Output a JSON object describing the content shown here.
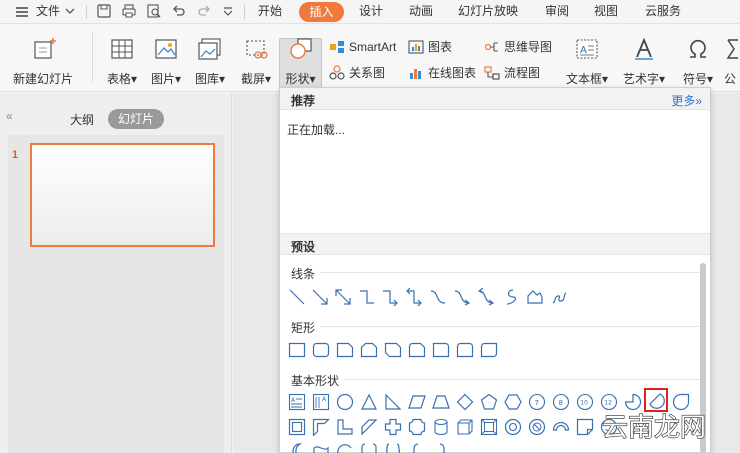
{
  "menubar": {
    "file_label": "文件",
    "tabs": [
      "开始",
      "插入",
      "设计",
      "动画",
      "幻灯片放映",
      "审阅",
      "视图",
      "云服务"
    ],
    "active_tab": "插入"
  },
  "ribbon": {
    "new_slide": "新建幻灯片",
    "table": "表格",
    "picture": "图片",
    "gallery": "图库",
    "screenshot": "截屏",
    "shape": "形状",
    "smartart": "SmartArt",
    "relation": "关系图",
    "chart": "图表",
    "online_chart": "在线图表",
    "mindmap": "思维导图",
    "flowchart": "流程图",
    "textbox": "文本框",
    "wordart": "艺术字",
    "symbol": "符号",
    "formula_partial": "公"
  },
  "left_panel": {
    "collapse_glyph": "«",
    "tab_outline": "大纲",
    "tab_slides": "幻灯片",
    "slide_number": "1"
  },
  "dropdown": {
    "recommend_title": "推荐",
    "more_label": "更多»",
    "loading_text": "正在加载...",
    "preset_title": "预设",
    "categories": {
      "lines": "线条",
      "rectangles": "矩形",
      "basic": "基本形状"
    },
    "numbered_badges": [
      "7",
      "8",
      "10",
      "12"
    ],
    "highlight_color": "#e02020"
  },
  "watermark": {
    "text": "云南龙网"
  },
  "colors": {
    "accent": "#f07a3c",
    "link": "#2e75d4",
    "shape_stroke": "#3a6fb0"
  }
}
